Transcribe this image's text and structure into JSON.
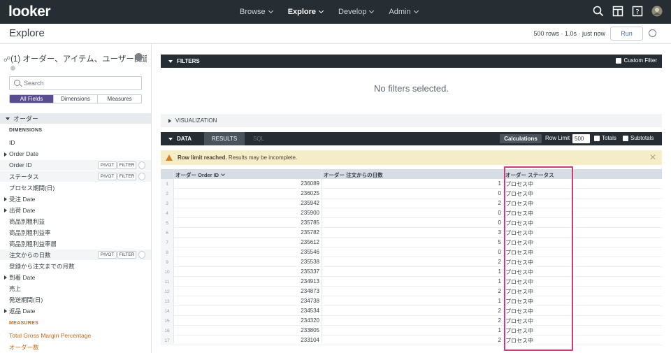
{
  "topnav": {
    "logo": "looker",
    "menu": [
      {
        "label": "Browse",
        "active": false
      },
      {
        "label": "Explore",
        "active": true
      },
      {
        "label": "Develop",
        "active": false
      },
      {
        "label": "Admin",
        "active": false
      }
    ],
    "icons": [
      "search-icon",
      "layout-icon",
      "help-icon",
      "user-avatar"
    ]
  },
  "header": {
    "title": "Explore",
    "run_info": "500 rows · 1.0s · just now",
    "run_label": "Run"
  },
  "sidebar": {
    "explore_title": "(1) オーダー、アイテム、ユーザー関連",
    "search_placeholder": "Search",
    "tabs": [
      "All Fields",
      "Dimensions",
      "Measures"
    ],
    "view_name": "オーダー",
    "dimensions_label": "DIMENSIONS",
    "measures_label": "MEASURES",
    "pivot_label": "PIVOT",
    "filter_label": "FILTER",
    "fields": [
      {
        "label": "ID",
        "group": false,
        "buttons": false
      },
      {
        "label": "Order Date",
        "group": true,
        "buttons": false
      },
      {
        "label": "Order ID",
        "group": false,
        "buttons": true
      },
      {
        "label": "ステータス",
        "group": false,
        "buttons": true
      },
      {
        "label": "プロセス期間(日)",
        "group": false,
        "buttons": false
      },
      {
        "label": "受注 Date",
        "group": true,
        "buttons": false
      },
      {
        "label": "出荷 Date",
        "group": true,
        "buttons": false
      },
      {
        "label": "商品別粗利益",
        "group": false,
        "buttons": false
      },
      {
        "label": "商品別粗利益率",
        "group": false,
        "buttons": false
      },
      {
        "label": "商品別粗利益率層",
        "group": false,
        "buttons": false
      },
      {
        "label": "注文からの日数",
        "group": false,
        "buttons": true
      },
      {
        "label": "登録から注文までの月数",
        "group": false,
        "buttons": false
      },
      {
        "label": "到着 Date",
        "group": true,
        "buttons": false
      },
      {
        "label": "売上",
        "group": false,
        "buttons": false
      },
      {
        "label": "発送期間(日)",
        "group": false,
        "buttons": false
      },
      {
        "label": "返品 Date",
        "group": true,
        "buttons": false
      }
    ],
    "measures": [
      "Total Gross Margin Percentage",
      "オーダー数"
    ]
  },
  "filters": {
    "title": "FILTERS",
    "custom_filter_label": "Custom Filter",
    "empty_message": "No filters selected."
  },
  "visualization": {
    "title": "VISUALIZATION"
  },
  "data_section": {
    "title": "DATA",
    "tabs": [
      "RESULTS",
      "SQL"
    ],
    "calculations_label": "Calculations",
    "row_limit_label": "Row Limit",
    "row_limit_value": "500",
    "totals_label": "Totals",
    "subtotals_label": "Subtotals"
  },
  "warning": {
    "bold": "Row limit reached.",
    "text": "Results may be incomplete.",
    "close": "✕"
  },
  "table": {
    "columns": [
      "オーダー Order ID",
      "オーダー 注文からの日数",
      "オーダー ステータス"
    ],
    "rows": [
      {
        "n": "1",
        "order_id": "236089",
        "days": "1",
        "status": "プロセス中"
      },
      {
        "n": "2",
        "order_id": "236025",
        "days": "0",
        "status": "プロセス中"
      },
      {
        "n": "3",
        "order_id": "235942",
        "days": "2",
        "status": "プロセス中"
      },
      {
        "n": "4",
        "order_id": "235900",
        "days": "0",
        "status": "プロセス中"
      },
      {
        "n": "5",
        "order_id": "235785",
        "days": "0",
        "status": "プロセス中"
      },
      {
        "n": "6",
        "order_id": "235782",
        "days": "3",
        "status": "プロセス中"
      },
      {
        "n": "7",
        "order_id": "235612",
        "days": "5",
        "status": "プロセス中"
      },
      {
        "n": "8",
        "order_id": "235546",
        "days": "0",
        "status": "プロセス中"
      },
      {
        "n": "9",
        "order_id": "235538",
        "days": "2",
        "status": "プロセス中"
      },
      {
        "n": "10",
        "order_id": "235337",
        "days": "1",
        "status": "プロセス中"
      },
      {
        "n": "11",
        "order_id": "234913",
        "days": "1",
        "status": "プロセス中"
      },
      {
        "n": "12",
        "order_id": "234873",
        "days": "2",
        "status": "プロセス中"
      },
      {
        "n": "13",
        "order_id": "234738",
        "days": "1",
        "status": "プロセス中"
      },
      {
        "n": "14",
        "order_id": "234534",
        "days": "2",
        "status": "プロセス中"
      },
      {
        "n": "15",
        "order_id": "234320",
        "days": "2",
        "status": "プロセス中"
      },
      {
        "n": "16",
        "order_id": "233805",
        "days": "1",
        "status": "プロセス中"
      },
      {
        "n": "17",
        "order_id": "233104",
        "days": "2",
        "status": "プロセス中"
      }
    ]
  },
  "colors": {
    "nav_bg": "#262d33",
    "accent_purple": "#5a4d8f",
    "measure_orange": "#c46b19",
    "highlight_pink": "#cf3a7d",
    "warning_bg": "#f5edc8"
  }
}
